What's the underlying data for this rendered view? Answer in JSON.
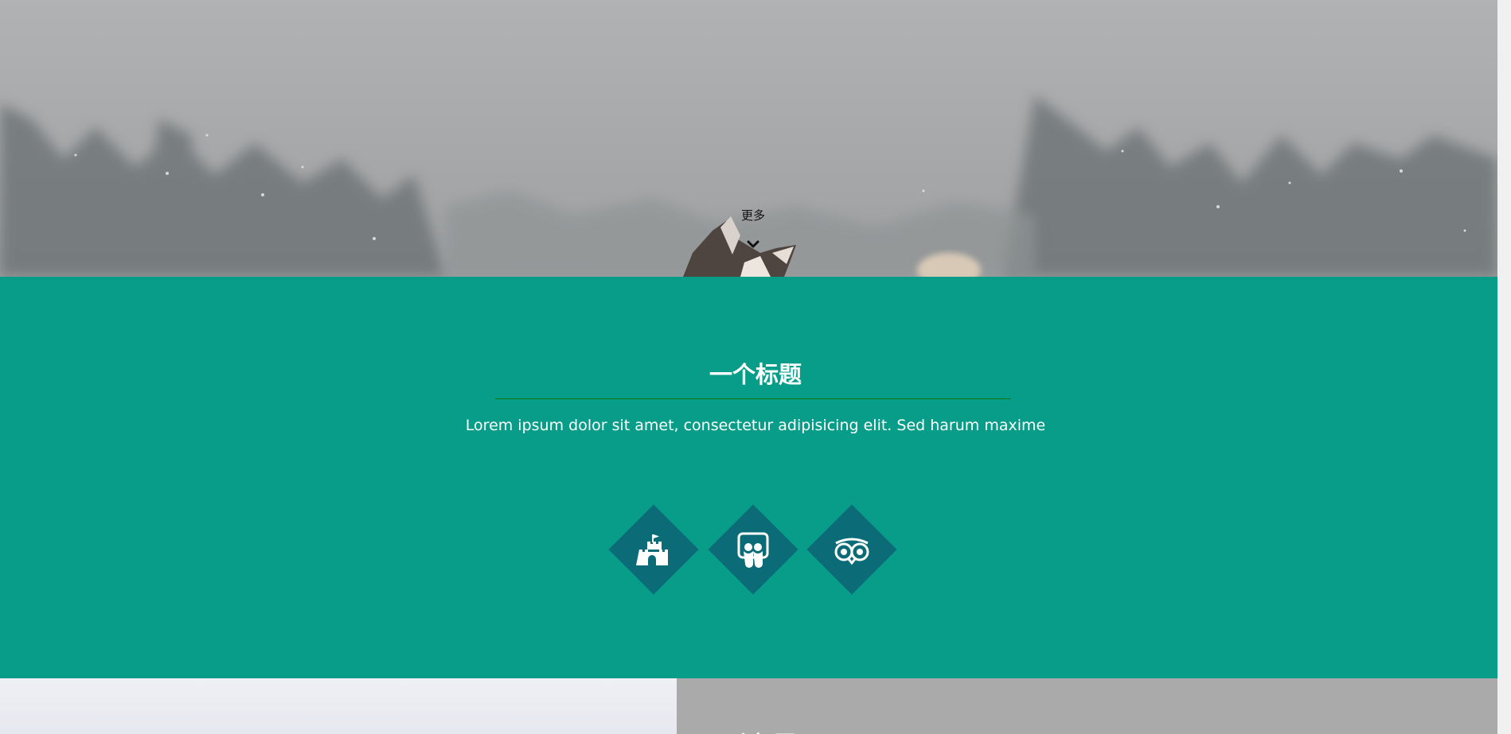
{
  "hero": {
    "more_label": "更多",
    "chevron_icon": "chevron-down-icon"
  },
  "feature": {
    "title": "一个标题",
    "description": "Lorem ipsum dolor sit amet, consectetur adipisicing elit. Sed harum maxime",
    "background_color": "#079d89",
    "diamond_color": "#0b6c78",
    "icons": [
      {
        "icon": "castle-icon"
      },
      {
        "icon": "slideshare-icon"
      },
      {
        "icon": "tripadvisor-owl-icon"
      }
    ]
  },
  "next_section": {
    "title": "一个标题",
    "panel_color": "#aaaaaa"
  }
}
